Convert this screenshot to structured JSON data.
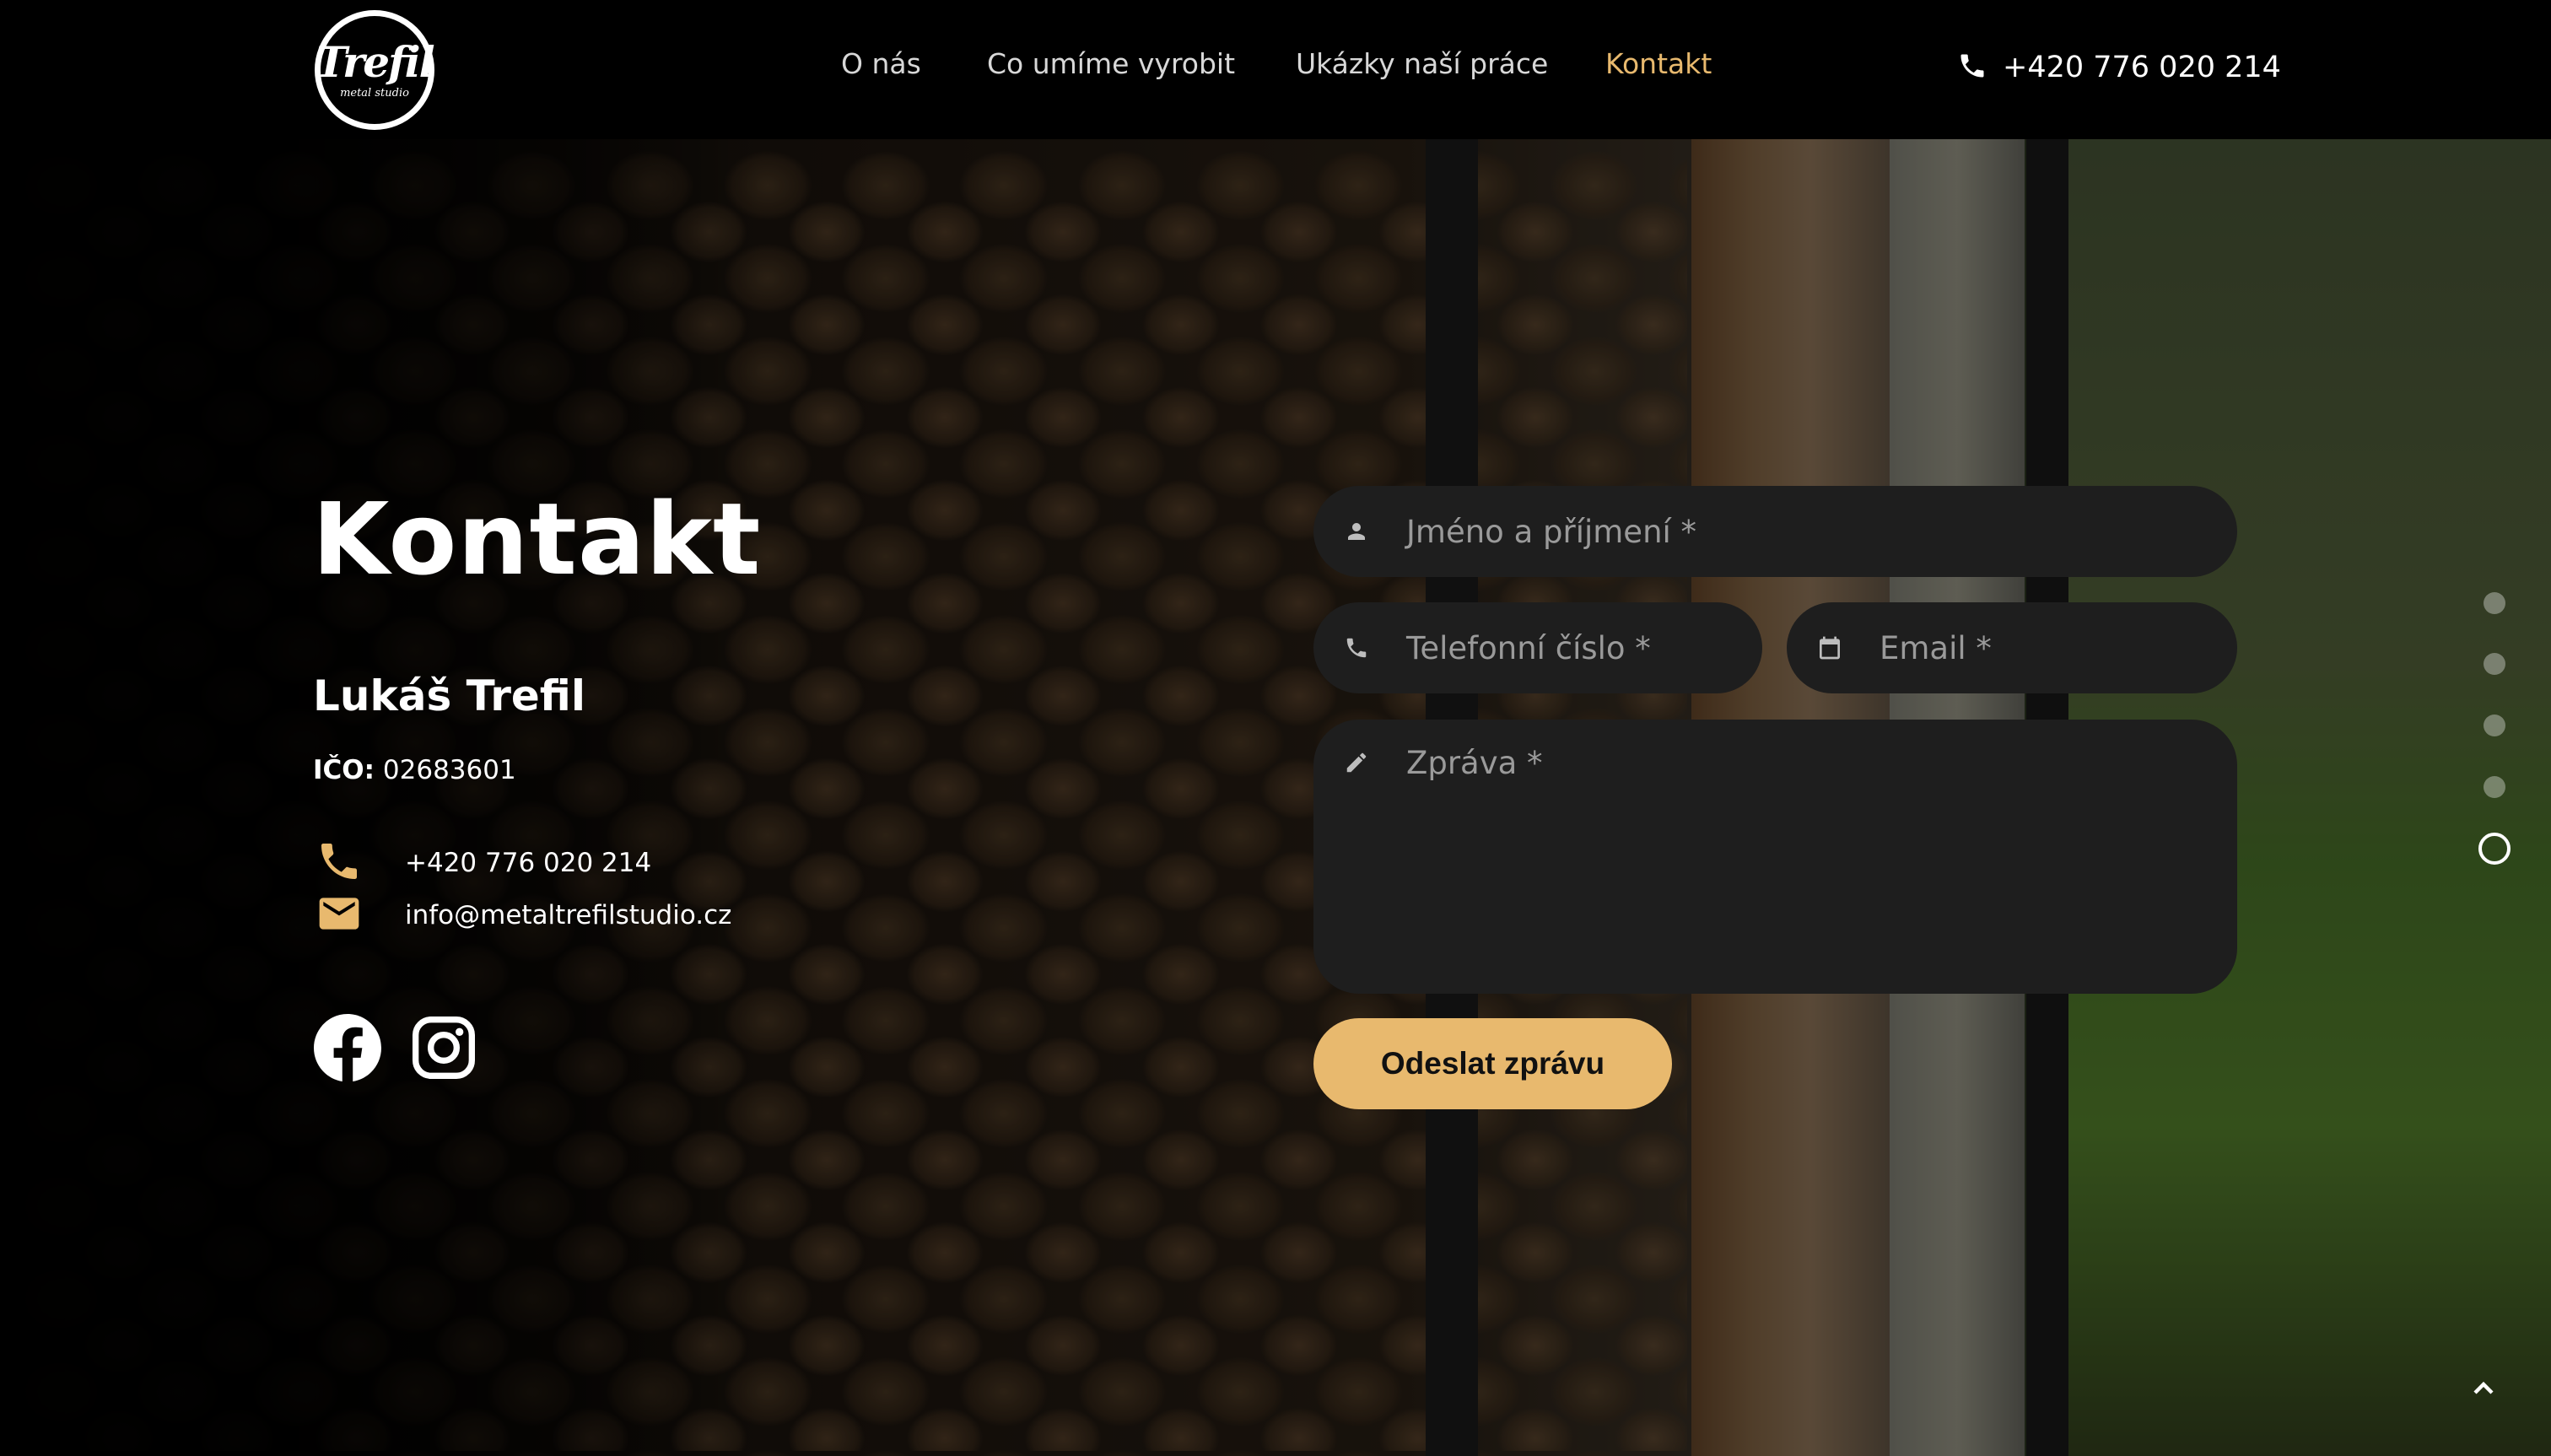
{
  "header": {
    "logo": {
      "brand": "Trefil",
      "sub": "metal studio"
    },
    "nav": [
      {
        "label": "O nás"
      },
      {
        "label": "Co umíme vyrobit"
      },
      {
        "label": "Ukázky naší práce"
      },
      {
        "label": "Kontakt",
        "active": true
      }
    ],
    "phone": "+420 776 020 214",
    "icon": "phone-icon"
  },
  "main": {
    "title": "Kontakt",
    "person": "Lukáš Trefil",
    "ico_label": "IČO:",
    "ico_value": "02683601",
    "contacts": [
      {
        "icon": "phone-icon",
        "text": "+420 776 020 214"
      },
      {
        "icon": "mail-icon",
        "text": "info@metaltrefilstudio.cz"
      }
    ],
    "social": [
      {
        "icon": "facebook-icon"
      },
      {
        "icon": "instagram-icon"
      }
    ]
  },
  "form": {
    "name_placeholder": "Jméno a příjmení *",
    "phone_placeholder": "Telefonní číslo *",
    "email_placeholder": "Email *",
    "message_placeholder": "Zpráva *",
    "submit_label": "Odeslat zprávu"
  },
  "side_nav": {
    "count": 5,
    "active_index": 4
  },
  "colors": {
    "accent": "#e8b96e",
    "field_bg": "#1e1e1e",
    "header_bg": "#000000"
  }
}
